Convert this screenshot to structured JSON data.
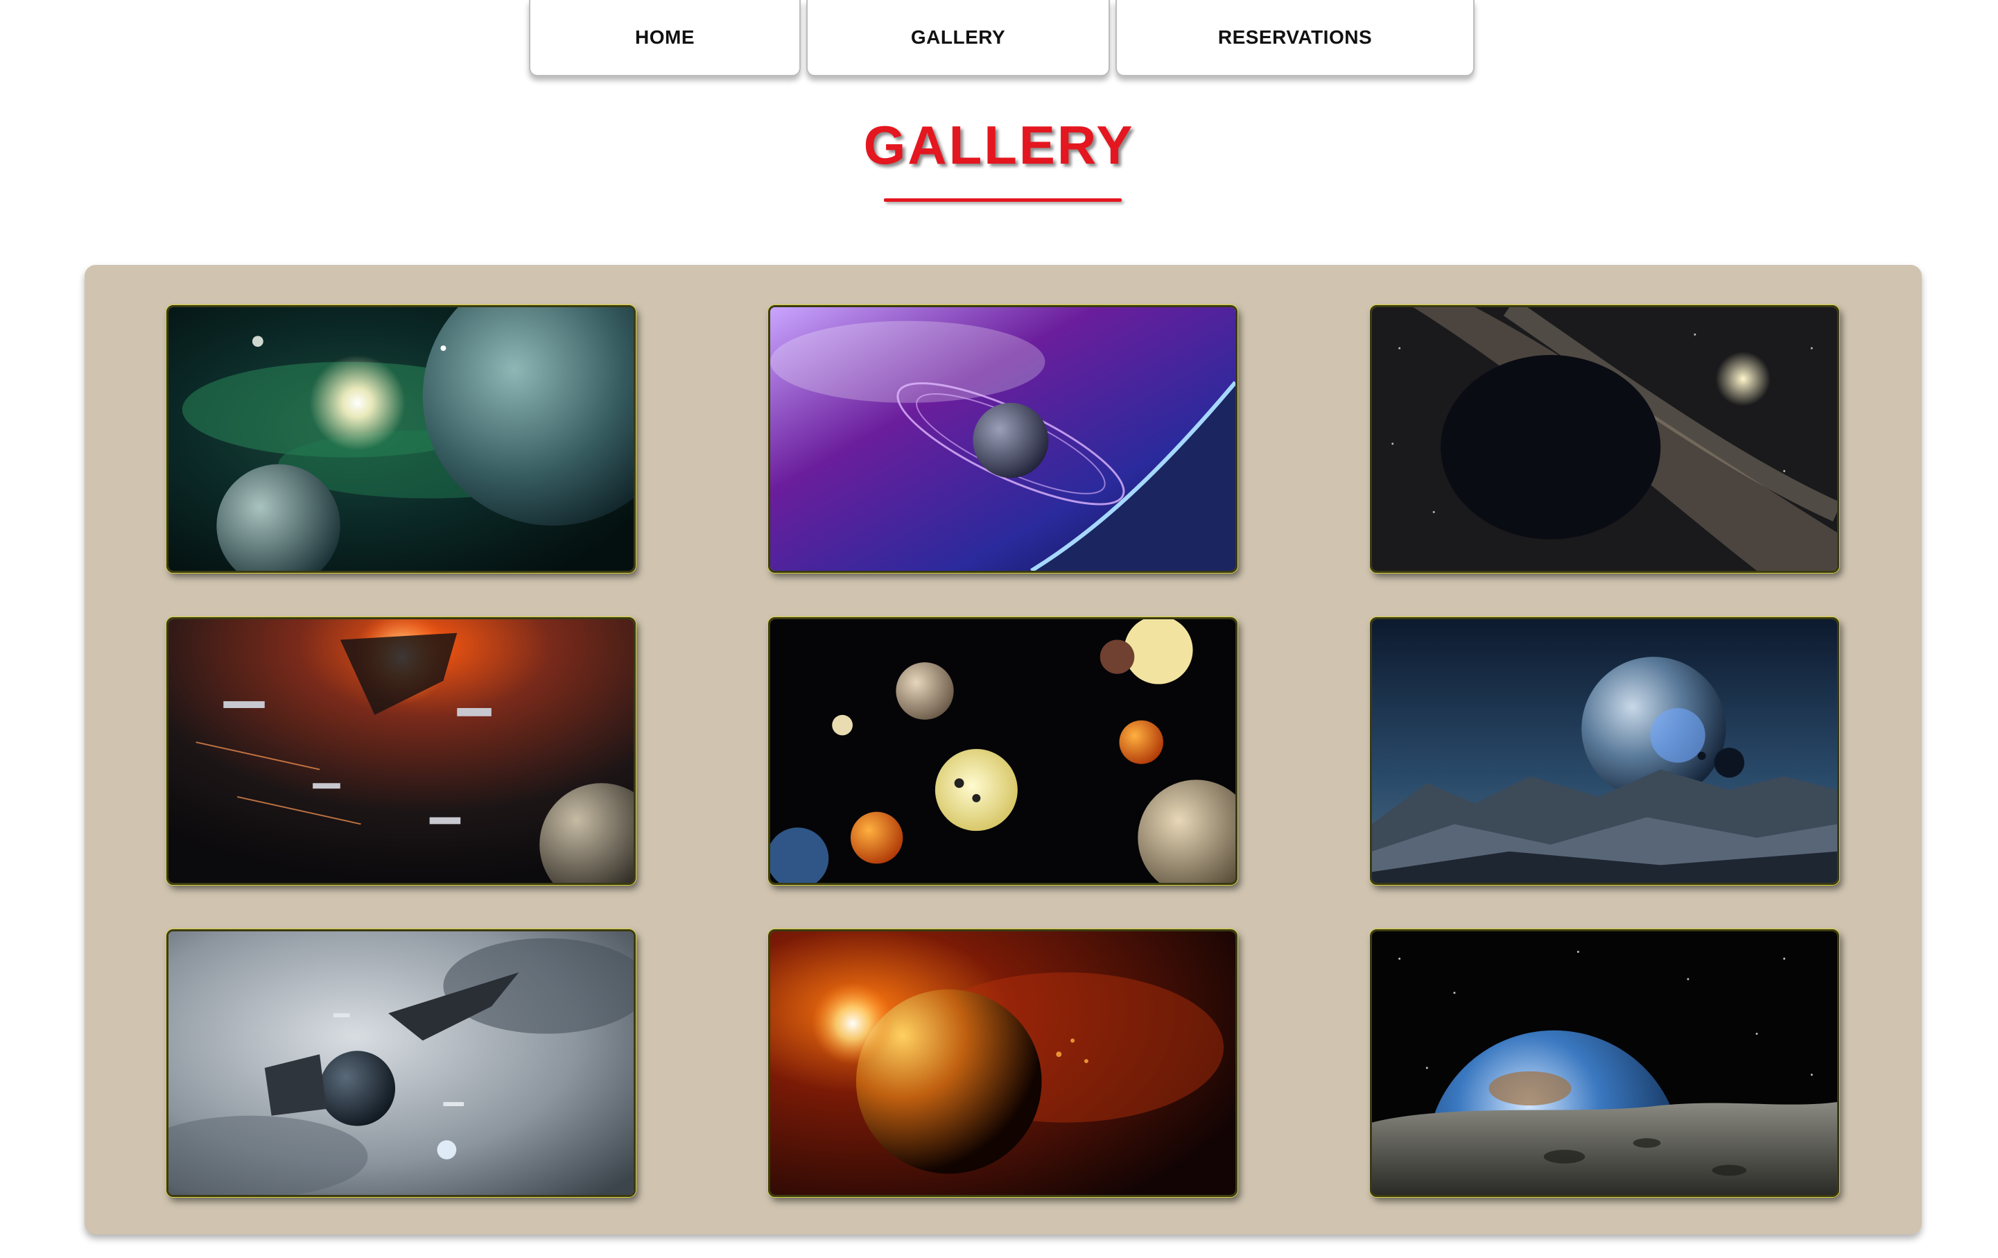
{
  "nav": {
    "items": [
      {
        "label": "HOME"
      },
      {
        "label": "GALLERY"
      },
      {
        "label": "RESERVATIONS"
      }
    ]
  },
  "page": {
    "title": "GALLERY"
  },
  "colors": {
    "accent": "#e4161f",
    "panel": "#d0c4b0",
    "thumb_border": "#d9d43a"
  },
  "gallery": {
    "images": [
      {
        "subject": "green nebula with planets"
      },
      {
        "subject": "purple ringed planet"
      },
      {
        "subject": "dark planet against milky way"
      },
      {
        "subject": "space battle near red star"
      },
      {
        "subject": "solar system planets"
      },
      {
        "subject": "planet over rocky alien landscape"
      },
      {
        "subject": "spaceships in grey clouds"
      },
      {
        "subject": "burning orange planet"
      },
      {
        "subject": "earth rising over moon surface"
      }
    ]
  }
}
